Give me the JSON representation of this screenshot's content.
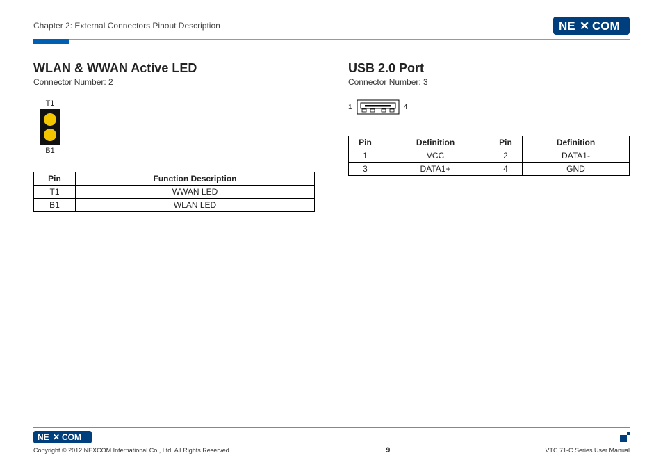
{
  "header": {
    "chapter": "Chapter 2: External Connectors Pinout Description",
    "logo_text_left": "NE",
    "logo_text_right": "COM"
  },
  "left": {
    "title": "WLAN & WWAN Active LED",
    "connector": "Connector Number: 2",
    "diagram": {
      "top_label": "T1",
      "bottom_label": "B1"
    },
    "table": {
      "headers": [
        "Pin",
        "Function Description"
      ],
      "rows": [
        [
          "T1",
          "WWAN LED"
        ],
        [
          "B1",
          "WLAN LED"
        ]
      ]
    }
  },
  "right": {
    "title": "USB 2.0 Port",
    "connector": "Connector Number: 3",
    "diagram": {
      "left_pin": "1",
      "right_pin": "4"
    },
    "table": {
      "headers": [
        "Pin",
        "Definition",
        "Pin",
        "Definition"
      ],
      "rows": [
        [
          "1",
          "VCC",
          "2",
          "DATA1-"
        ],
        [
          "3",
          "DATA1+",
          "4",
          "GND"
        ]
      ]
    }
  },
  "footer": {
    "logo_text_left": "NE",
    "logo_text_right": "COM",
    "copyright": "Copyright © 2012 NEXCOM International Co., Ltd. All Rights Reserved.",
    "page_number": "9",
    "manual": "VTC 71-C Series User Manual"
  }
}
